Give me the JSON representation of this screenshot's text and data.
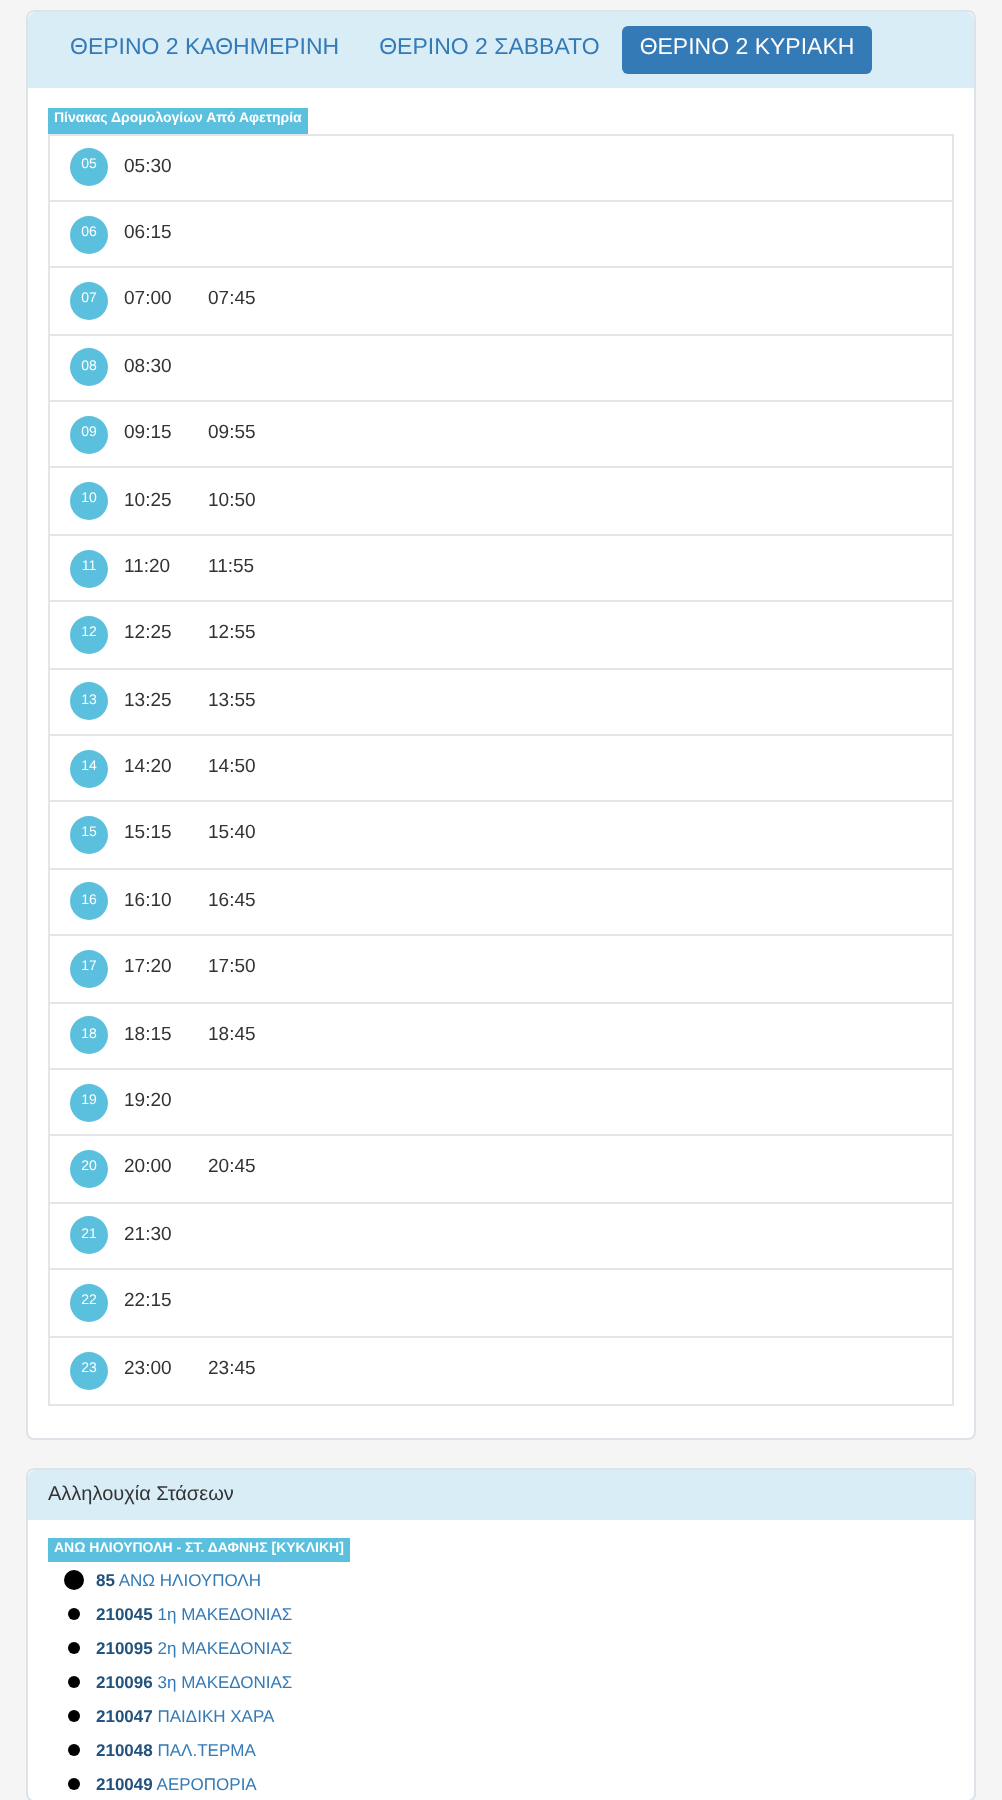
{
  "tabs": [
    {
      "label": "ΘΕΡΙΝΟ 2 ΚΑΘΗΜΕΡΙΝΗ",
      "selected": false
    },
    {
      "label": "ΘΕΡΙΝΟ 2 ΣΑΒΒΑΤΟ",
      "selected": false
    },
    {
      "label": "ΘΕΡΙΝΟ 2 ΚΥΡΙΑΚΗ",
      "selected": true
    }
  ],
  "schedule": {
    "label": "Πίνακας Δρομολογίων Από Αφετηρία",
    "rows": [
      {
        "hour": "05",
        "times": [
          "05:30"
        ]
      },
      {
        "hour": "06",
        "times": [
          "06:15"
        ]
      },
      {
        "hour": "07",
        "times": [
          "07:00",
          "07:45"
        ]
      },
      {
        "hour": "08",
        "times": [
          "08:30"
        ]
      },
      {
        "hour": "09",
        "times": [
          "09:15",
          "09:55"
        ]
      },
      {
        "hour": "10",
        "times": [
          "10:25",
          "10:50"
        ]
      },
      {
        "hour": "11",
        "times": [
          "11:20",
          "11:55"
        ]
      },
      {
        "hour": "12",
        "times": [
          "12:25",
          "12:55"
        ]
      },
      {
        "hour": "13",
        "times": [
          "13:25",
          "13:55"
        ]
      },
      {
        "hour": "14",
        "times": [
          "14:20",
          "14:50"
        ]
      },
      {
        "hour": "15",
        "times": [
          "15:15",
          "15:40"
        ]
      },
      {
        "hour": "16",
        "times": [
          "16:10",
          "16:45"
        ]
      },
      {
        "hour": "17",
        "times": [
          "17:20",
          "17:50"
        ]
      },
      {
        "hour": "18",
        "times": [
          "18:15",
          "18:45"
        ]
      },
      {
        "hour": "19",
        "times": [
          "19:20"
        ]
      },
      {
        "hour": "20",
        "times": [
          "20:00",
          "20:45"
        ]
      },
      {
        "hour": "21",
        "times": [
          "21:30"
        ]
      },
      {
        "hour": "22",
        "times": [
          "22:15"
        ]
      },
      {
        "hour": "23",
        "times": [
          "23:00",
          "23:45"
        ]
      }
    ]
  },
  "stops_panel": {
    "title": "Αλληλουχία Στάσεων",
    "route": "ΑΝΩ ΗΛΙΟΥΠΟΛΗ - ΣΤ. ΔΑΦΝΗΣ [ΚΥΚΛΙΚΗ]",
    "stops": [
      {
        "kind": "terminal",
        "code": "85",
        "name": "ΑΝΩ ΗΛΙΟΥΠΟΛΗ"
      },
      {
        "kind": "stop",
        "code": "210045",
        "name": "1η ΜΑΚΕΔΟΝΙΑΣ"
      },
      {
        "kind": "stop",
        "code": "210095",
        "name": "2η ΜΑΚΕΔΟΝΙΑΣ"
      },
      {
        "kind": "stop",
        "code": "210096",
        "name": "3η ΜΑΚΕΔΟΝΙΑΣ"
      },
      {
        "kind": "stop",
        "code": "210047",
        "name": "ΠΑΙΔΙΚΗ ΧΑΡΑ"
      },
      {
        "kind": "stop",
        "code": "210048",
        "name": "ΠΑΛ.ΤΕΡΜΑ"
      },
      {
        "kind": "stop",
        "code": "210049",
        "name": "ΑΕΡΟΠΟΡΙΑ"
      }
    ]
  }
}
